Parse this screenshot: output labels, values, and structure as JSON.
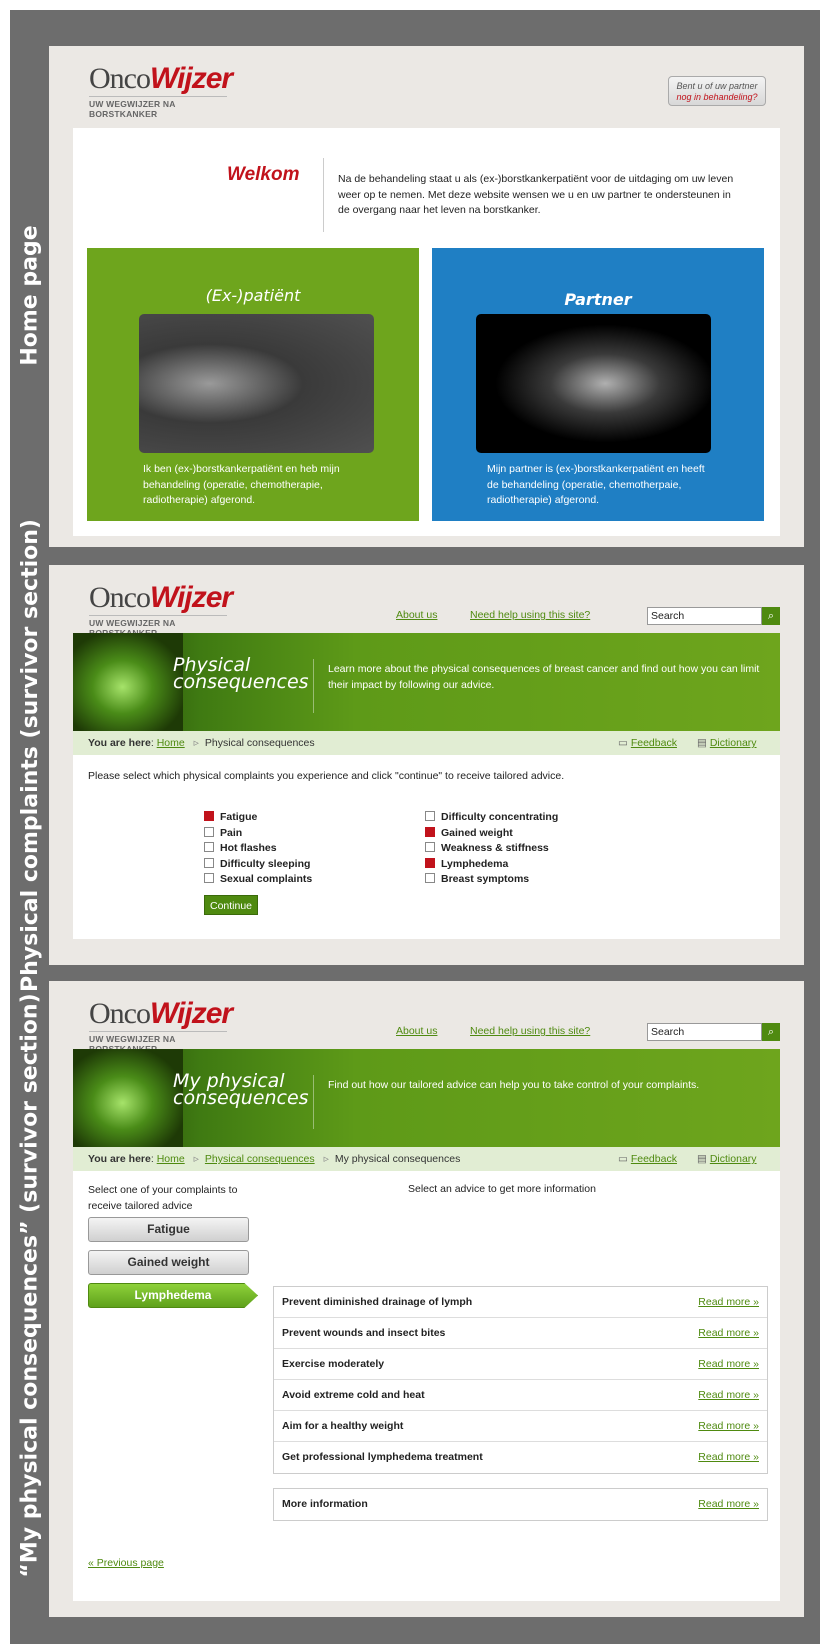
{
  "sidebar_labels": {
    "home": "Home page",
    "complaints": "Physical complaints (survivor section)",
    "my": "“My physical consequences” (survivor section)"
  },
  "logo": {
    "onco": "Onco",
    "wijzer": "Wijzer",
    "tagline": "UW WEGWIJZER NA BORSTKANKER"
  },
  "home": {
    "treatment_button": {
      "line1": "Bent u of uw partner",
      "line2": "nog in behandeling?"
    },
    "welcome_title": "Welkom",
    "welcome_text": "Na de behandeling staat u als (ex-)borstkankerpatiënt voor de uitdaging om uw leven weer op te nemen. Met deze website wensen we u en uw partner te ondersteunen in de overgang naar het leven na borstkanker.",
    "patient": {
      "title": "(Ex-)patiënt",
      "text": "Ik ben (ex-)borstkankerpatiënt en heb mijn behandeling (operatie, chemotherapie, radiotherapie) afgerond."
    },
    "partner": {
      "title": "Partner",
      "text": "Mijn partner is (ex-)borstkankerpatiënt en heeft de behandeling (operatie, chemotherpaie, radiotherapie) afgerond."
    }
  },
  "nav": {
    "about": "About us",
    "help": "Need help using this site?",
    "search": "Search"
  },
  "complaints": {
    "banner_title_1": "Physical",
    "banner_title_2": "consequences",
    "banner_text": "Learn more about the physical consequences of breast cancer and find out how you can limit their impact by following our advice.",
    "crumb": {
      "you_are_here": "You are here",
      "home": "Home",
      "current": "Physical consequences",
      "feedback": "Feedback",
      "dictionary": "Dictionary"
    },
    "instruction": "Please select which physical complaints you experience and click \"continue\" to receive tailored advice.",
    "left_options": [
      {
        "label": "Fatigue",
        "checked": true
      },
      {
        "label": "Pain",
        "checked": false
      },
      {
        "label": "Hot flashes",
        "checked": false
      },
      {
        "label": "Difficulty sleeping",
        "checked": false
      },
      {
        "label": "Sexual complaints",
        "checked": false
      }
    ],
    "right_options": [
      {
        "label": "Difficulty concentrating",
        "checked": false
      },
      {
        "label": "Gained weight",
        "checked": true
      },
      {
        "label": "Weakness & stiffness",
        "checked": false
      },
      {
        "label": "Lymphedema",
        "checked": true
      },
      {
        "label": "Breast symptoms",
        "checked": false
      }
    ],
    "continue": "Continue"
  },
  "my": {
    "banner_title_1": "My physical",
    "banner_title_2": "consequences",
    "banner_text": "Find out how our tailored advice can help you to take control of your complaints.",
    "crumb": {
      "you_are_here": "You are here",
      "home": "Home",
      "mid": "Physical consequences",
      "current": "My physical consequences",
      "feedback": "Feedback",
      "dictionary": "Dictionary"
    },
    "select_complaint": "Select one of your complaints to receive tailored advice",
    "select_advice": "Select an advice to get more information",
    "complaints": [
      "Fatigue",
      "Gained weight",
      "Lymphedema"
    ],
    "advices": [
      "Prevent diminished drainage of lymph",
      "Prevent wounds and insect bites",
      "Exercise moderately",
      "Avoid extreme cold and heat",
      "Aim for a healthy weight",
      "Get professional lymphedema treatment"
    ],
    "read_more": "Read more »",
    "more_info": "More information",
    "prev": "« Previous page"
  },
  "colors": {
    "green": "#6ea51d",
    "blue": "#1f7fc4",
    "red": "#c1121b"
  }
}
